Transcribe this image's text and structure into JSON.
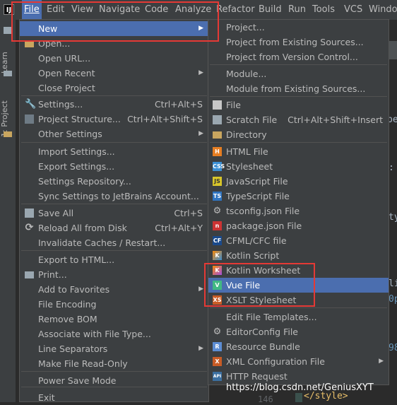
{
  "menubar": {
    "app_icon_text": "IJ",
    "items": [
      "File",
      "Edit",
      "View",
      "Navigate",
      "Code",
      "Analyze",
      "Refactor",
      "Build",
      "Run",
      "Tools",
      "VCS",
      "Window"
    ]
  },
  "left_strip": {
    "learn": "Learn",
    "project": "1: Project"
  },
  "file_menu": [
    {
      "label": "New",
      "submenu": true,
      "selected": true
    },
    {
      "label": "Open...",
      "icon": "folder-icon"
    },
    {
      "label": "Open URL..."
    },
    {
      "label": "Open Recent",
      "submenu": true
    },
    {
      "label": "Close Project"
    },
    {
      "sep": true
    },
    {
      "label": "Settings...",
      "shortcut": "Ctrl+Alt+S",
      "icon": "wrench-icon"
    },
    {
      "label": "Project Structure...",
      "shortcut": "Ctrl+Alt+Shift+S",
      "icon": "project-structure-icon"
    },
    {
      "label": "Other Settings",
      "submenu": true
    },
    {
      "sep": true
    },
    {
      "label": "Import Settings..."
    },
    {
      "label": "Export Settings..."
    },
    {
      "label": "Settings Repository..."
    },
    {
      "label": "Sync Settings to JetBrains Account..."
    },
    {
      "sep": true
    },
    {
      "label": "Save All",
      "shortcut": "Ctrl+S",
      "icon": "save-icon"
    },
    {
      "label": "Reload All from Disk",
      "shortcut": "Ctrl+Alt+Y",
      "icon": "reload-icon"
    },
    {
      "label": "Invalidate Caches / Restart..."
    },
    {
      "sep": true
    },
    {
      "label": "Export to HTML..."
    },
    {
      "label": "Print...",
      "icon": "print-icon"
    },
    {
      "label": "Add to Favorites",
      "submenu": true
    },
    {
      "label": "File Encoding"
    },
    {
      "label": "Remove BOM"
    },
    {
      "label": "Associate with File Type..."
    },
    {
      "label": "Line Separators",
      "submenu": true
    },
    {
      "label": "Make File Read-Only"
    },
    {
      "sep": true
    },
    {
      "label": "Power Save Mode"
    },
    {
      "sep": true
    },
    {
      "label": "Exit"
    }
  ],
  "new_menu": [
    {
      "label": "Project..."
    },
    {
      "label": "Project from Existing Sources..."
    },
    {
      "label": "Project from Version Control..."
    },
    {
      "sep": true
    },
    {
      "label": "Module..."
    },
    {
      "label": "Module from Existing Sources..."
    },
    {
      "sep": true
    },
    {
      "label": "File",
      "icon": "file-icon"
    },
    {
      "label": "Scratch File",
      "shortcut": "Ctrl+Alt+Shift+Insert",
      "icon": "scratch-file-icon"
    },
    {
      "label": "Directory",
      "icon": "directory-icon"
    },
    {
      "sep": true
    },
    {
      "label": "HTML File",
      "icon": "html-file-icon",
      "glyph": "H"
    },
    {
      "label": "Stylesheet",
      "icon": "css-file-icon",
      "glyph": "CSS"
    },
    {
      "label": "JavaScript File",
      "icon": "js-file-icon",
      "glyph": "JS"
    },
    {
      "label": "TypeScript File",
      "icon": "ts-file-icon",
      "glyph": "TS"
    },
    {
      "label": "tsconfig.json File",
      "icon": "gear-icon",
      "glyph": "⚙"
    },
    {
      "label": "package.json File",
      "icon": "npm-icon",
      "glyph": "n"
    },
    {
      "label": "CFML/CFC file",
      "icon": "cfml-file-icon",
      "glyph": "CF"
    },
    {
      "label": "Kotlin Script",
      "icon": "kotlin-script-icon",
      "glyph": "K"
    },
    {
      "label": "Kotlin Worksheet",
      "icon": "kotlin-worksheet-icon",
      "glyph": "K"
    },
    {
      "label": "Vue File",
      "icon": "vue-file-icon",
      "glyph": "V",
      "selected": true
    },
    {
      "label": "XSLT Stylesheet",
      "icon": "xslt-file-icon",
      "glyph": "XS"
    },
    {
      "sep": true
    },
    {
      "label": "Edit File Templates...",
      "icon": "file-templates-icon"
    },
    {
      "label": "EditorConfig File",
      "icon": "editorconfig-icon",
      "glyph": "⚙"
    },
    {
      "label": "Resource Bundle",
      "icon": "resource-bundle-icon",
      "glyph": "R"
    },
    {
      "label": "XML Configuration File",
      "icon": "xml-file-icon",
      "glyph": "X",
      "submenu": true
    },
    {
      "label": "HTTP Request",
      "icon": "http-request-icon",
      "glyph": "API"
    }
  ],
  "editor": {
    "fragments": [
      "pe",
      ":",
      "ty",
      "li",
      "0p",
      "98"
    ],
    "gutter_number": "146",
    "closing_tag": "</style>"
  },
  "watermark": "https://blog.csdn.net/GeniusXYT",
  "colors": {
    "selection": "#4b6eaf",
    "highlight": "#e53935",
    "menu_bg": "#3c3f41"
  }
}
